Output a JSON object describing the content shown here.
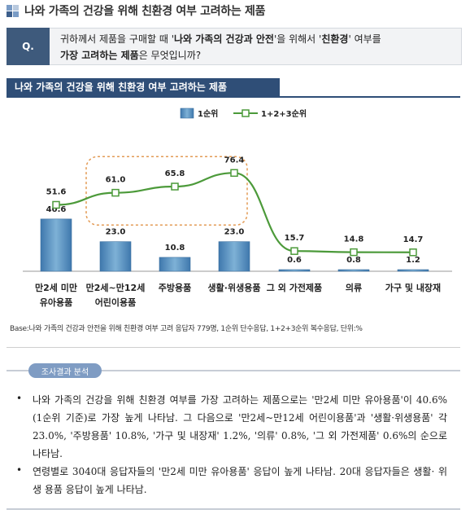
{
  "header": {
    "title": "나와 가족의 건강을 위해 친환경 여부 고려하는 제품"
  },
  "question": {
    "badge": "Q.",
    "text_1": "귀하께서 제품을 구매할 때 '",
    "text_bold_1": "나와 가족의 건강과 안전",
    "text_2": "'을 위해서 '",
    "text_bold_2": "친환경",
    "text_3": "' 여부를",
    "text_bold_3": "가장 고려하는 제품",
    "text_4": "은 무엇입니까?"
  },
  "chart_title": "나와 가족의 건강을 위해 친환경 여부 고려하는 제품",
  "chart_data": {
    "type": "bar",
    "categories": [
      [
        "만2세 미만",
        "유아용품"
      ],
      [
        "만2세~만12세",
        "어린이용품"
      ],
      [
        "주방용품"
      ],
      [
        "생활·위생용품"
      ],
      [
        "그 외 가전제품"
      ],
      [
        "의류"
      ],
      [
        "가구 및 내장재"
      ]
    ],
    "series": [
      {
        "name": "1순위",
        "type": "bar",
        "values": [
          40.6,
          23.0,
          10.8,
          23.0,
          0.6,
          0.8,
          1.2
        ],
        "labels": [
          "40.6",
          "23.0",
          "10.8",
          "23.0",
          "0.6",
          "0.8",
          "1.2"
        ],
        "color": "#7eb1d6"
      },
      {
        "name": "1+2+3순위",
        "type": "line",
        "values": [
          51.6,
          61.0,
          65.8,
          76.4,
          15.7,
          14.8,
          14.7
        ],
        "labels": [
          "51.6",
          "61.0",
          "65.8",
          "76.4",
          "15.7",
          "14.8",
          "14.7"
        ],
        "color": "#4c9a3a"
      }
    ],
    "ylim": [
      0,
      80
    ],
    "legend_position": "top-center",
    "grid": false,
    "highlight": "dashed rounded box around 만2세~만12세, 주방용품, 생활·위생용품 line points"
  },
  "base_note": "Base:나와 가족의 건강과 안전을 위해 친환경 여부 고려 응답자 779명, 1순위 단수응답, 1+2+3순위 복수응답, 단위:%",
  "analysis": {
    "badge": "조사결과 분석",
    "bullets": [
      "나와 가족의 건강을 위해 친환경 여부를 가장 고려하는 제품으로는 '만2세 미만 유아용품'이 40.6% (1순위 기준)로 가장 높게 나타남. 그 다음으로 '만2세~만12세 어린이용품'과 '생활·위생용품' 각 23.0%, '주방용품' 10.8%, '가구 및 내장재' 1.2%, '의류' 0.8%, '그 외 가전제품' 0.6%의 순으로 나타남.",
      "연령별로 3040대 응답자들의 '만2세 미만 유아용품' 응답이 높게 나타남. 20대 응답자들은 생활· 위생 용품 응답이 높게 나타남."
    ]
  },
  "colors": {
    "heading_icon": [
      "#7a9cc6",
      "#b8c9de",
      "#3d5f8c",
      "#7a9cc6"
    ],
    "title_bar": "#2f4e77",
    "bar": "#7eb1d6",
    "line": "#4c9a3a",
    "highlight_box": "#e39b55"
  }
}
